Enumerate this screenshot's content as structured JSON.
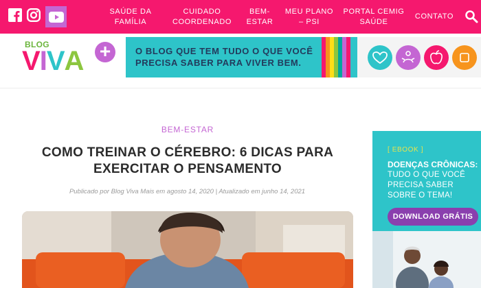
{
  "topbar": {
    "nav": [
      {
        "line1": "Saúde da",
        "line2": "Família"
      },
      {
        "line1": "Cuidado",
        "line2": "Coordenado"
      },
      {
        "line1": "Bem-",
        "line2": "Estar"
      },
      {
        "line1": "Meu Plano",
        "line2": "– PSI"
      },
      {
        "line1": "Portal Cemig",
        "line2": "Saúde"
      },
      {
        "line1": "Contato",
        "line2": ""
      }
    ],
    "social_icons": [
      "facebook-icon",
      "instagram-icon",
      "youtube-icon"
    ],
    "search_icon": "search-icon",
    "color": "#f5186e"
  },
  "header": {
    "logo": {
      "small": "BLOG",
      "letters": [
        "V",
        "I",
        "V",
        "A"
      ],
      "plus": "+"
    },
    "banner_text": "O blog que tem tudo o que você precisa saber para viver bem.",
    "banner_color": "#2ec4c9",
    "stripe_colors": [
      "#f5186e",
      "#f7941d",
      "#ffde17",
      "#8cc63f",
      "#00a79d",
      "#c466d3"
    ],
    "circles": [
      {
        "icon": "heart-icon",
        "color": "#2ec4c9"
      },
      {
        "icon": "meditation-icon",
        "color": "#c466d3"
      },
      {
        "icon": "apple-icon",
        "color": "#f5186e"
      },
      {
        "icon": "orange-circle-icon",
        "color": "#f7941d"
      }
    ]
  },
  "article": {
    "category": "BEM-ESTAR",
    "title": "Como treinar o cérebro: 6 dicas para exercitar o pensamento",
    "meta": "Publicado por Blog Viva Mais em agosto 14, 2020 | Atualizado em junho 14, 2021"
  },
  "sidebar_ad": {
    "tag": "[ EBOOK ]",
    "title": "Doenças Crônicas:",
    "body": "Tudo o que você precisa saber sobre o tema!",
    "button": "Download Grátis"
  }
}
